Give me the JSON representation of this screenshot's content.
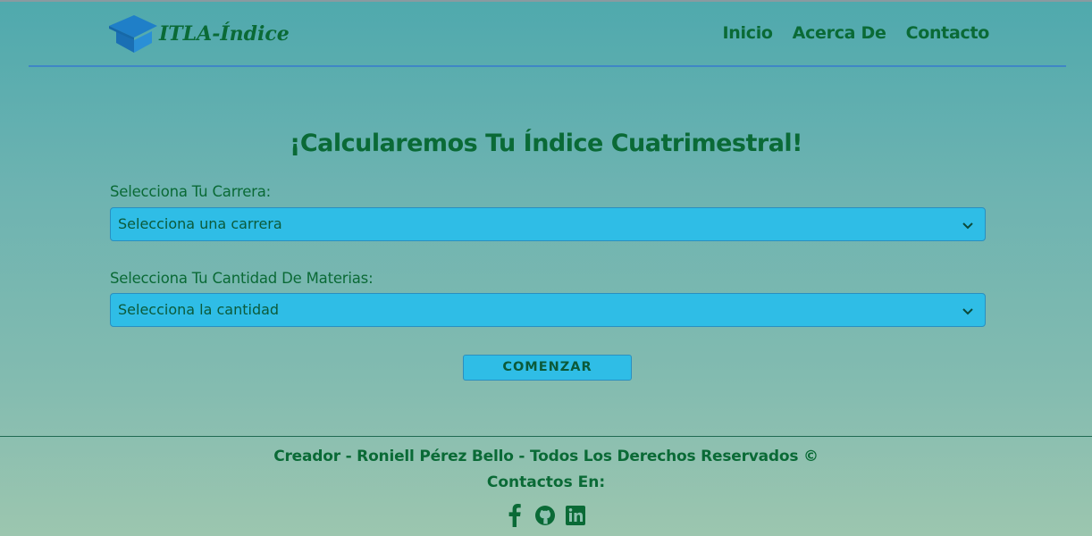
{
  "header": {
    "logo_text": "ITLA-Índice",
    "logo_icon": "graduation-cap-icon",
    "nav": [
      {
        "label": "Inicio"
      },
      {
        "label": "Acerca De"
      },
      {
        "label": "Contacto"
      }
    ]
  },
  "main": {
    "title": "¡Calcularemos Tu Índice Cuatrimestral!",
    "career": {
      "label": "Selecciona Tu Carrera:",
      "selected": "Selecciona una carrera"
    },
    "subjects": {
      "label": "Selecciona Tu Cantidad De Materias:",
      "selected": "Selecciona la cantidad"
    },
    "start_button": "COMENZAR"
  },
  "footer": {
    "credit": "Creador - Roniell Pérez Bello - Todos Los Derechos Reservados ©",
    "contacts_label": "Contactos En:",
    "social_icons": [
      "facebook-icon",
      "github-icon",
      "linkedin-icon"
    ]
  },
  "colors": {
    "primary_text": "#0a6a36",
    "field_bg": "#2fbde6",
    "header_rule": "#3f86c6",
    "logo_blue": "#1f7fc8"
  }
}
